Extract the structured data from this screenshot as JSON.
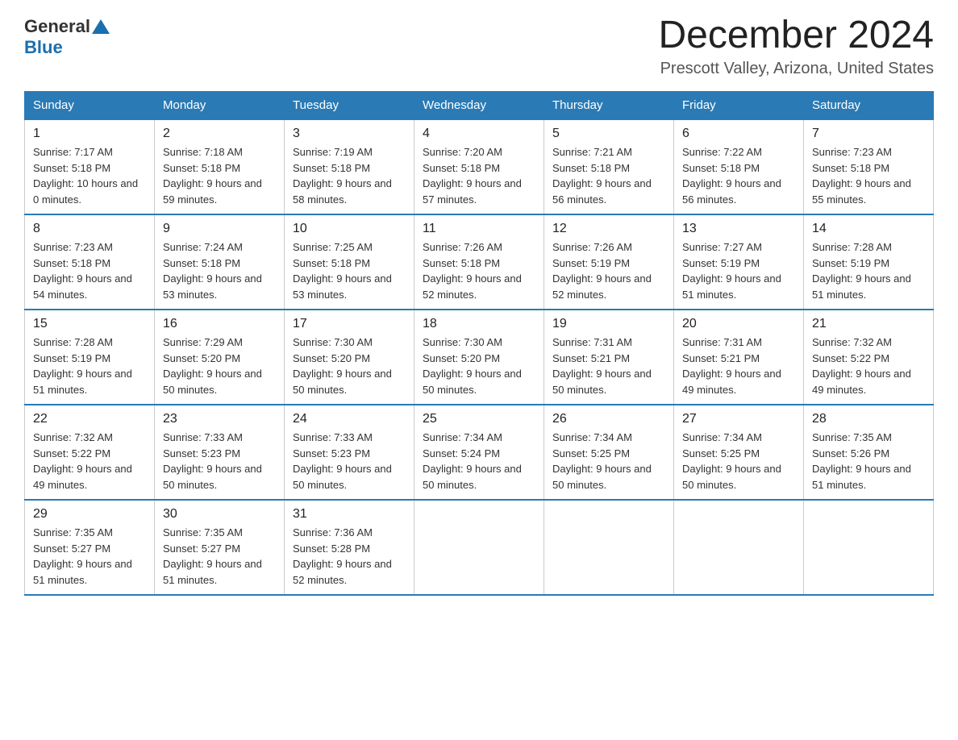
{
  "logo": {
    "text_general": "General",
    "text_blue": "Blue"
  },
  "title": {
    "month": "December 2024",
    "location": "Prescott Valley, Arizona, United States"
  },
  "weekdays": [
    "Sunday",
    "Monday",
    "Tuesday",
    "Wednesday",
    "Thursday",
    "Friday",
    "Saturday"
  ],
  "weeks": [
    [
      {
        "day": "1",
        "sunrise": "Sunrise: 7:17 AM",
        "sunset": "Sunset: 5:18 PM",
        "daylight": "Daylight: 10 hours and 0 minutes."
      },
      {
        "day": "2",
        "sunrise": "Sunrise: 7:18 AM",
        "sunset": "Sunset: 5:18 PM",
        "daylight": "Daylight: 9 hours and 59 minutes."
      },
      {
        "day": "3",
        "sunrise": "Sunrise: 7:19 AM",
        "sunset": "Sunset: 5:18 PM",
        "daylight": "Daylight: 9 hours and 58 minutes."
      },
      {
        "day": "4",
        "sunrise": "Sunrise: 7:20 AM",
        "sunset": "Sunset: 5:18 PM",
        "daylight": "Daylight: 9 hours and 57 minutes."
      },
      {
        "day": "5",
        "sunrise": "Sunrise: 7:21 AM",
        "sunset": "Sunset: 5:18 PM",
        "daylight": "Daylight: 9 hours and 56 minutes."
      },
      {
        "day": "6",
        "sunrise": "Sunrise: 7:22 AM",
        "sunset": "Sunset: 5:18 PM",
        "daylight": "Daylight: 9 hours and 56 minutes."
      },
      {
        "day": "7",
        "sunrise": "Sunrise: 7:23 AM",
        "sunset": "Sunset: 5:18 PM",
        "daylight": "Daylight: 9 hours and 55 minutes."
      }
    ],
    [
      {
        "day": "8",
        "sunrise": "Sunrise: 7:23 AM",
        "sunset": "Sunset: 5:18 PM",
        "daylight": "Daylight: 9 hours and 54 minutes."
      },
      {
        "day": "9",
        "sunrise": "Sunrise: 7:24 AM",
        "sunset": "Sunset: 5:18 PM",
        "daylight": "Daylight: 9 hours and 53 minutes."
      },
      {
        "day": "10",
        "sunrise": "Sunrise: 7:25 AM",
        "sunset": "Sunset: 5:18 PM",
        "daylight": "Daylight: 9 hours and 53 minutes."
      },
      {
        "day": "11",
        "sunrise": "Sunrise: 7:26 AM",
        "sunset": "Sunset: 5:18 PM",
        "daylight": "Daylight: 9 hours and 52 minutes."
      },
      {
        "day": "12",
        "sunrise": "Sunrise: 7:26 AM",
        "sunset": "Sunset: 5:19 PM",
        "daylight": "Daylight: 9 hours and 52 minutes."
      },
      {
        "day": "13",
        "sunrise": "Sunrise: 7:27 AM",
        "sunset": "Sunset: 5:19 PM",
        "daylight": "Daylight: 9 hours and 51 minutes."
      },
      {
        "day": "14",
        "sunrise": "Sunrise: 7:28 AM",
        "sunset": "Sunset: 5:19 PM",
        "daylight": "Daylight: 9 hours and 51 minutes."
      }
    ],
    [
      {
        "day": "15",
        "sunrise": "Sunrise: 7:28 AM",
        "sunset": "Sunset: 5:19 PM",
        "daylight": "Daylight: 9 hours and 51 minutes."
      },
      {
        "day": "16",
        "sunrise": "Sunrise: 7:29 AM",
        "sunset": "Sunset: 5:20 PM",
        "daylight": "Daylight: 9 hours and 50 minutes."
      },
      {
        "day": "17",
        "sunrise": "Sunrise: 7:30 AM",
        "sunset": "Sunset: 5:20 PM",
        "daylight": "Daylight: 9 hours and 50 minutes."
      },
      {
        "day": "18",
        "sunrise": "Sunrise: 7:30 AM",
        "sunset": "Sunset: 5:20 PM",
        "daylight": "Daylight: 9 hours and 50 minutes."
      },
      {
        "day": "19",
        "sunrise": "Sunrise: 7:31 AM",
        "sunset": "Sunset: 5:21 PM",
        "daylight": "Daylight: 9 hours and 50 minutes."
      },
      {
        "day": "20",
        "sunrise": "Sunrise: 7:31 AM",
        "sunset": "Sunset: 5:21 PM",
        "daylight": "Daylight: 9 hours and 49 minutes."
      },
      {
        "day": "21",
        "sunrise": "Sunrise: 7:32 AM",
        "sunset": "Sunset: 5:22 PM",
        "daylight": "Daylight: 9 hours and 49 minutes."
      }
    ],
    [
      {
        "day": "22",
        "sunrise": "Sunrise: 7:32 AM",
        "sunset": "Sunset: 5:22 PM",
        "daylight": "Daylight: 9 hours and 49 minutes."
      },
      {
        "day": "23",
        "sunrise": "Sunrise: 7:33 AM",
        "sunset": "Sunset: 5:23 PM",
        "daylight": "Daylight: 9 hours and 50 minutes."
      },
      {
        "day": "24",
        "sunrise": "Sunrise: 7:33 AM",
        "sunset": "Sunset: 5:23 PM",
        "daylight": "Daylight: 9 hours and 50 minutes."
      },
      {
        "day": "25",
        "sunrise": "Sunrise: 7:34 AM",
        "sunset": "Sunset: 5:24 PM",
        "daylight": "Daylight: 9 hours and 50 minutes."
      },
      {
        "day": "26",
        "sunrise": "Sunrise: 7:34 AM",
        "sunset": "Sunset: 5:25 PM",
        "daylight": "Daylight: 9 hours and 50 minutes."
      },
      {
        "day": "27",
        "sunrise": "Sunrise: 7:34 AM",
        "sunset": "Sunset: 5:25 PM",
        "daylight": "Daylight: 9 hours and 50 minutes."
      },
      {
        "day": "28",
        "sunrise": "Sunrise: 7:35 AM",
        "sunset": "Sunset: 5:26 PM",
        "daylight": "Daylight: 9 hours and 51 minutes."
      }
    ],
    [
      {
        "day": "29",
        "sunrise": "Sunrise: 7:35 AM",
        "sunset": "Sunset: 5:27 PM",
        "daylight": "Daylight: 9 hours and 51 minutes."
      },
      {
        "day": "30",
        "sunrise": "Sunrise: 7:35 AM",
        "sunset": "Sunset: 5:27 PM",
        "daylight": "Daylight: 9 hours and 51 minutes."
      },
      {
        "day": "31",
        "sunrise": "Sunrise: 7:36 AM",
        "sunset": "Sunset: 5:28 PM",
        "daylight": "Daylight: 9 hours and 52 minutes."
      },
      null,
      null,
      null,
      null
    ]
  ]
}
